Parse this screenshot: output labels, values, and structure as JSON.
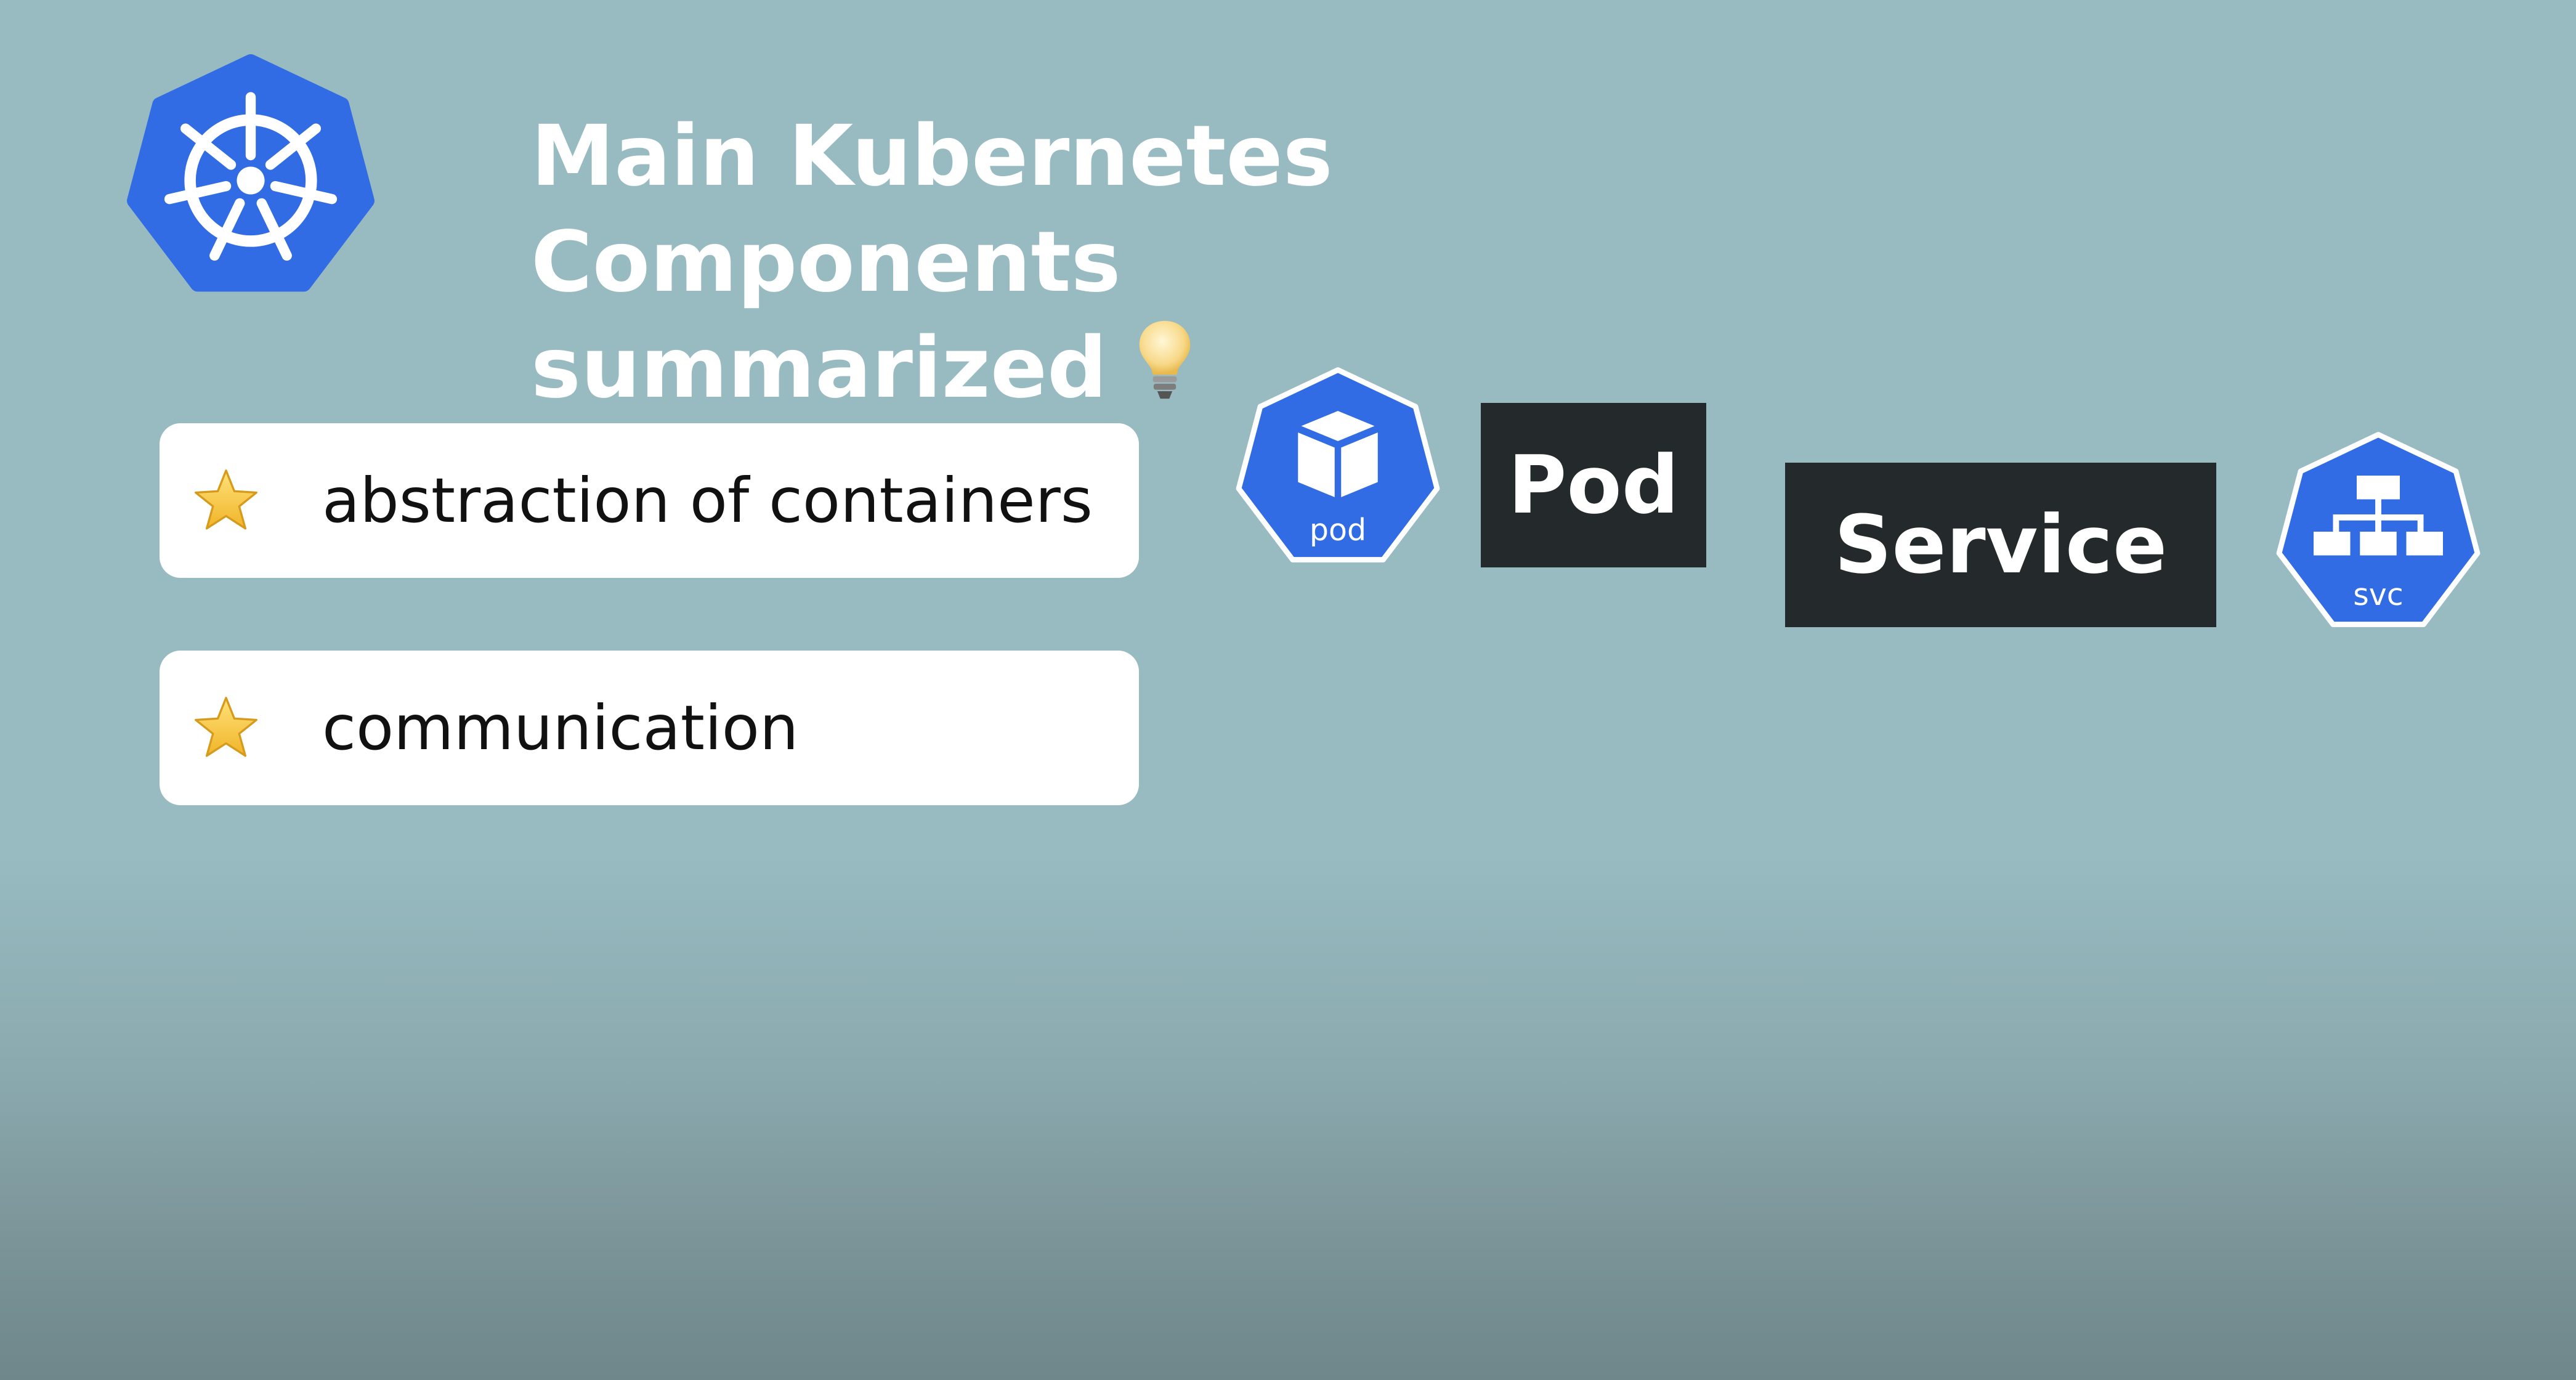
{
  "title": {
    "line1": "Main Kubernetes Components",
    "line2": "summarized"
  },
  "icons": {
    "logo": "kubernetes-helm-wheel-icon",
    "bulb": "lightbulb-icon",
    "star": "star-icon",
    "pod": "pod-cube-icon",
    "svc": "service-hierarchy-icon"
  },
  "colors": {
    "background": "#97bbc1",
    "kubernetes_blue": "#326ce5",
    "label_dark": "#242a2b",
    "card": "#ffffff",
    "star": "#f5c542"
  },
  "cards": [
    {
      "text": "abstraction of containers"
    },
    {
      "text": "communication"
    }
  ],
  "components": {
    "pod": {
      "icon_text": "pod",
      "label": "Pod"
    },
    "service": {
      "icon_text": "svc",
      "label": "Service"
    }
  }
}
